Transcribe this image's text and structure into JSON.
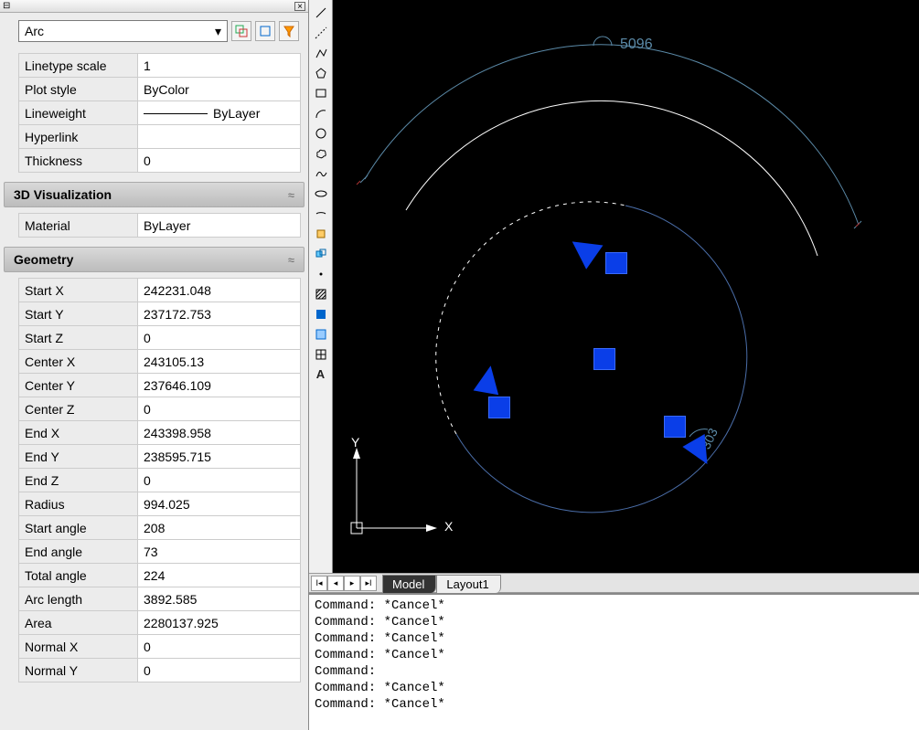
{
  "type_selector": {
    "value": "Arc"
  },
  "general_props": [
    {
      "label": "Linetype scale",
      "value": "1"
    },
    {
      "label": "Plot style",
      "value": "ByColor"
    },
    {
      "label": "Lineweight",
      "value": "ByLayer",
      "line": true
    },
    {
      "label": "Hyperlink",
      "value": ""
    },
    {
      "label": "Thickness",
      "value": "0"
    }
  ],
  "vis_header": "3D Visualization",
  "vis_props": [
    {
      "label": "Material",
      "value": "ByLayer"
    }
  ],
  "geom_header": "Geometry",
  "geom_props": [
    {
      "label": "Start X",
      "value": "242231.048"
    },
    {
      "label": "Start Y",
      "value": "237172.753"
    },
    {
      "label": "Start Z",
      "value": "0"
    },
    {
      "label": "Center X",
      "value": "243105.13"
    },
    {
      "label": "Center Y",
      "value": "237646.109"
    },
    {
      "label": "Center Z",
      "value": "0"
    },
    {
      "label": "End X",
      "value": "243398.958"
    },
    {
      "label": "End Y",
      "value": "238595.715"
    },
    {
      "label": "End Z",
      "value": "0"
    },
    {
      "label": "Radius",
      "value": "994.025"
    },
    {
      "label": "Start angle",
      "value": "208"
    },
    {
      "label": "End angle",
      "value": "73"
    },
    {
      "label": "Total angle",
      "value": "224"
    },
    {
      "label": "Arc length",
      "value": "3892.585"
    },
    {
      "label": "Area",
      "value": "2280137.925"
    },
    {
      "label": "Normal X",
      "value": "0"
    },
    {
      "label": "Normal Y",
      "value": "0"
    }
  ],
  "tabs": {
    "model": "Model",
    "layout1": "Layout1"
  },
  "cmd_lines": [
    "Command: *Cancel*",
    "Command: *Cancel*",
    "Command: *Cancel*",
    "Command: *Cancel*",
    "Command:",
    "Command: *Cancel*",
    "Command: *Cancel*"
  ],
  "dim_5096": "5096",
  "dim_303": "303",
  "ucs": {
    "x": "X",
    "y": "Y"
  }
}
